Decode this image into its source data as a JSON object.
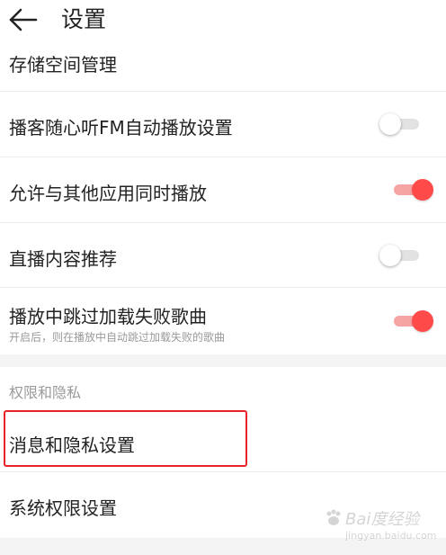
{
  "header": {
    "title": "设置",
    "back_icon": "arrow-left-icon"
  },
  "rows": {
    "storage": {
      "label": "存储空间管理"
    },
    "podcast_fm": {
      "label": "播客随心听FM自动播放设置",
      "toggle": "off"
    },
    "allow_other_apps": {
      "label": "允许与其他应用同时播放",
      "toggle": "on"
    },
    "live_recommend": {
      "label": "直播内容推荐",
      "toggle": "off"
    },
    "skip_failed": {
      "label": "播放中跳过加载失败歌曲",
      "description": "开启后，则在播放中自动跳过加载失败的歌曲",
      "toggle": "on"
    }
  },
  "section": {
    "title": "权限和隐私"
  },
  "privacy_rows": {
    "message_privacy": {
      "label": "消息和隐私设置"
    },
    "system_permission": {
      "label": "系统权限设置"
    }
  },
  "colors": {
    "toggle_on_knob": "#ff4a4a",
    "toggle_on_track": "#f6a3a3",
    "toggle_off_track": "#e2e2e2",
    "highlight_border": "#e8242a",
    "section_background": "#f4f4f4"
  },
  "watermark": {
    "text": "Bai度经验",
    "sub": "jingyan.baidu.com"
  }
}
